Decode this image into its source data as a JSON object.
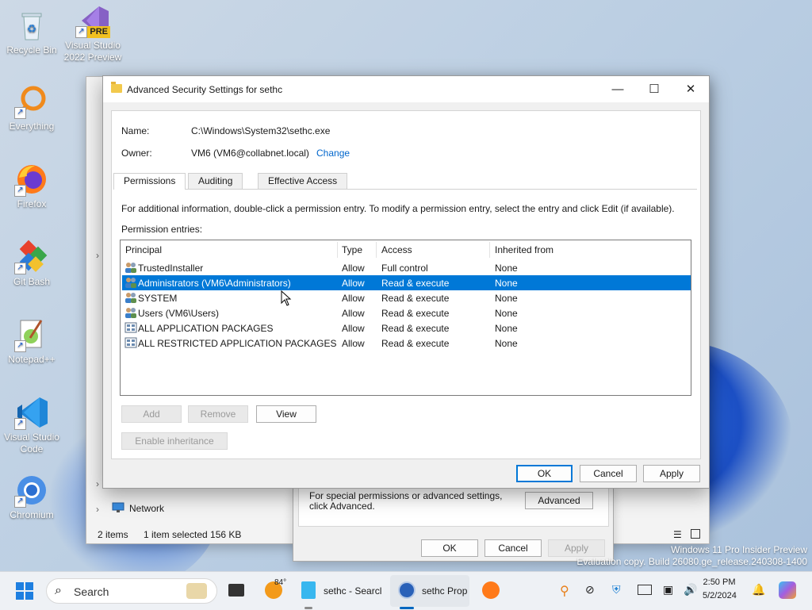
{
  "desktop": {
    "icons": [
      {
        "label": "Recycle Bin",
        "icon": "recycle-bin-icon"
      },
      {
        "label": "Visual Studio 2022 Preview",
        "icon": "visual-studio-icon",
        "badge": "PRE"
      },
      {
        "label": "Everything",
        "icon": "everything-search-icon"
      },
      {
        "label": "Firefox",
        "icon": "firefox-icon"
      },
      {
        "label": "Git Bash",
        "icon": "git-bash-icon"
      },
      {
        "label": "Notepad++",
        "icon": "notepadpp-icon"
      },
      {
        "label": "Visual Studio Code",
        "icon": "vscode-icon"
      },
      {
        "label": "Chromium",
        "icon": "chromium-icon"
      }
    ],
    "watermark_line1": "Windows 11 Pro Insider Preview",
    "watermark_line2": "Evaluation copy. Build 26080.ge_release.240308-1400"
  },
  "explorer": {
    "nav_network": "Network",
    "status_items": "2 items",
    "status_selected": "1 item selected  156 KB"
  },
  "properties_dialog": {
    "advanced_text": "For special permissions or advanced settings, click Advanced.",
    "advanced_button": "Advanced",
    "ok": "OK",
    "cancel": "Cancel",
    "apply": "Apply"
  },
  "dialog": {
    "title": "Advanced Security Settings for sethc",
    "name_label": "Name:",
    "name_value": "C:\\Windows\\System32\\sethc.exe",
    "owner_label": "Owner:",
    "owner_value": "VM6 (VM6@collabnet.local)",
    "change_link": "Change",
    "tabs": [
      "Permissions",
      "Auditing",
      "Effective Access"
    ],
    "info_text": "For additional information, double-click a permission entry. To modify a permission entry, select the entry and click Edit (if available).",
    "entries_label": "Permission entries:",
    "columns": [
      "Principal",
      "Type",
      "Access",
      "Inherited from"
    ],
    "rows": [
      {
        "principal": "TrustedInstaller",
        "type": "Allow",
        "access": "Full control",
        "inherited": "None",
        "icon": "users-group-icon"
      },
      {
        "principal": "Administrators (VM6\\Administrators)",
        "type": "Allow",
        "access": "Read & execute",
        "inherited": "None",
        "icon": "users-group-icon"
      },
      {
        "principal": "SYSTEM",
        "type": "Allow",
        "access": "Read & execute",
        "inherited": "None",
        "icon": "users-group-icon"
      },
      {
        "principal": "Users (VM6\\Users)",
        "type": "Allow",
        "access": "Read & execute",
        "inherited": "None",
        "icon": "users-group-icon"
      },
      {
        "principal": "ALL APPLICATION PACKAGES",
        "type": "Allow",
        "access": "Read & execute",
        "inherited": "None",
        "icon": "app-package-icon"
      },
      {
        "principal": "ALL RESTRICTED APPLICATION PACKAGES",
        "type": "Allow",
        "access": "Read & execute",
        "inherited": "None",
        "icon": "app-package-icon"
      }
    ],
    "add": "Add",
    "remove": "Remove",
    "view": "View",
    "enable_inheritance": "Enable inheritance",
    "ok": "OK",
    "cancel": "Cancel",
    "apply": "Apply"
  },
  "taskbar": {
    "search_placeholder": "Search",
    "weather_temp": "84°",
    "app1": "sethc - Searcl",
    "app2": "sethc Prop",
    "time": "2:50 PM",
    "date": "5/2/2024"
  },
  "colors": {
    "selection": "#0078d7",
    "link": "#0066cc"
  }
}
